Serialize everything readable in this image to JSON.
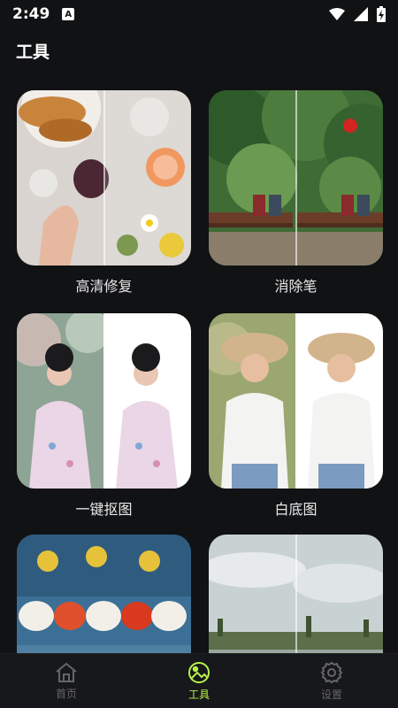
{
  "status": {
    "time": "2:49",
    "notif_glyph": "A"
  },
  "header": {
    "title": "工具"
  },
  "tools": [
    {
      "label": "高清修复",
      "image": "photo-breakfast-table"
    },
    {
      "label": "消除笔",
      "image": "photo-park-bench-balloon"
    },
    {
      "label": "一键抠图",
      "image": "photo-hanfu-woman"
    },
    {
      "label": "白底图",
      "image": "photo-woman-straw-hat"
    },
    {
      "label": "",
      "image": "photo-lanterns-building"
    },
    {
      "label": "",
      "image": "photo-sky-landscape"
    }
  ],
  "nav": {
    "items": [
      {
        "label": "首页",
        "icon": "home-icon"
      },
      {
        "label": "工具",
        "icon": "image-tool-icon"
      },
      {
        "label": "设置",
        "icon": "gear-icon"
      }
    ],
    "active_index": 1
  },
  "colors": {
    "accent": "#b6f24a",
    "background": "#111214",
    "nav_inactive": "#666666"
  }
}
